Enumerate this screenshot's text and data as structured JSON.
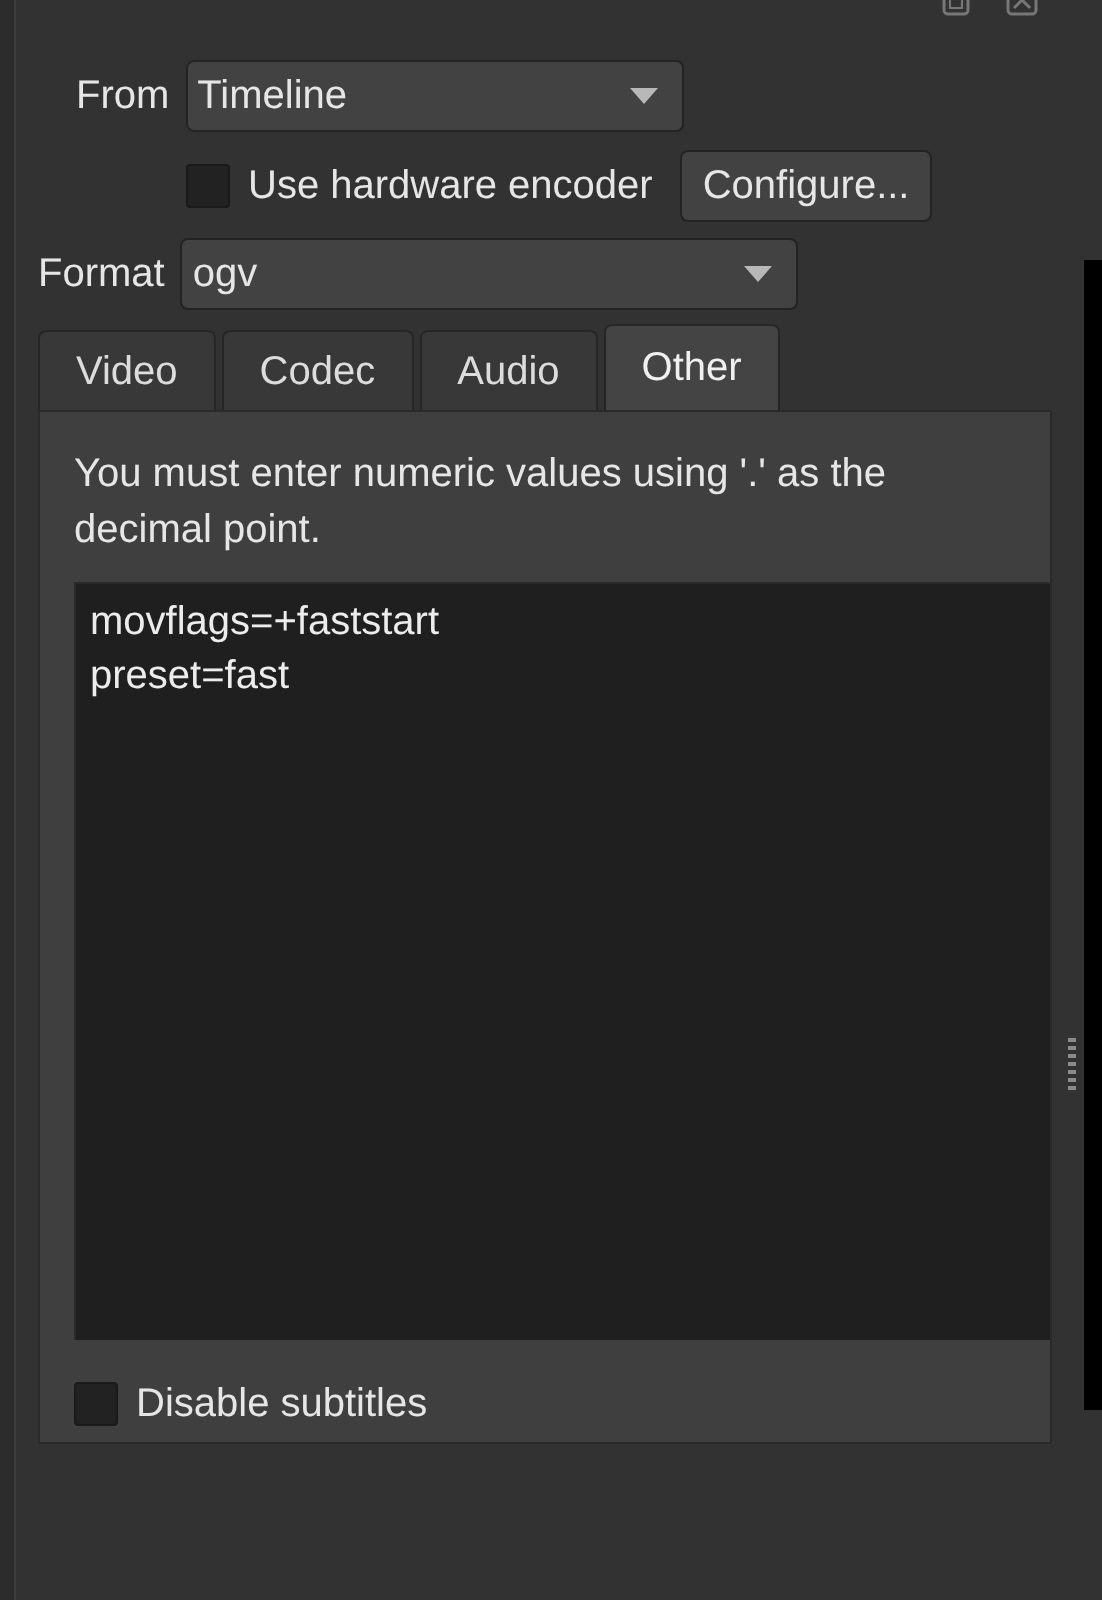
{
  "source": {
    "label": "From",
    "value": "Timeline"
  },
  "hardware_encoder": {
    "label": "Use hardware encoder",
    "checked": false,
    "button": "Configure..."
  },
  "format": {
    "label": "Format",
    "value": "ogv"
  },
  "tabs": [
    {
      "label": "Video",
      "selected": false
    },
    {
      "label": "Codec",
      "selected": false
    },
    {
      "label": "Audio",
      "selected": false
    },
    {
      "label": "Other",
      "selected": true
    }
  ],
  "other": {
    "note": "You must enter numeric values using '.' as the decimal point.",
    "options": [
      "movflags=+faststart",
      "preset=fast"
    ],
    "disable_subtitles": {
      "label": "Disable subtitles",
      "checked": false
    }
  }
}
